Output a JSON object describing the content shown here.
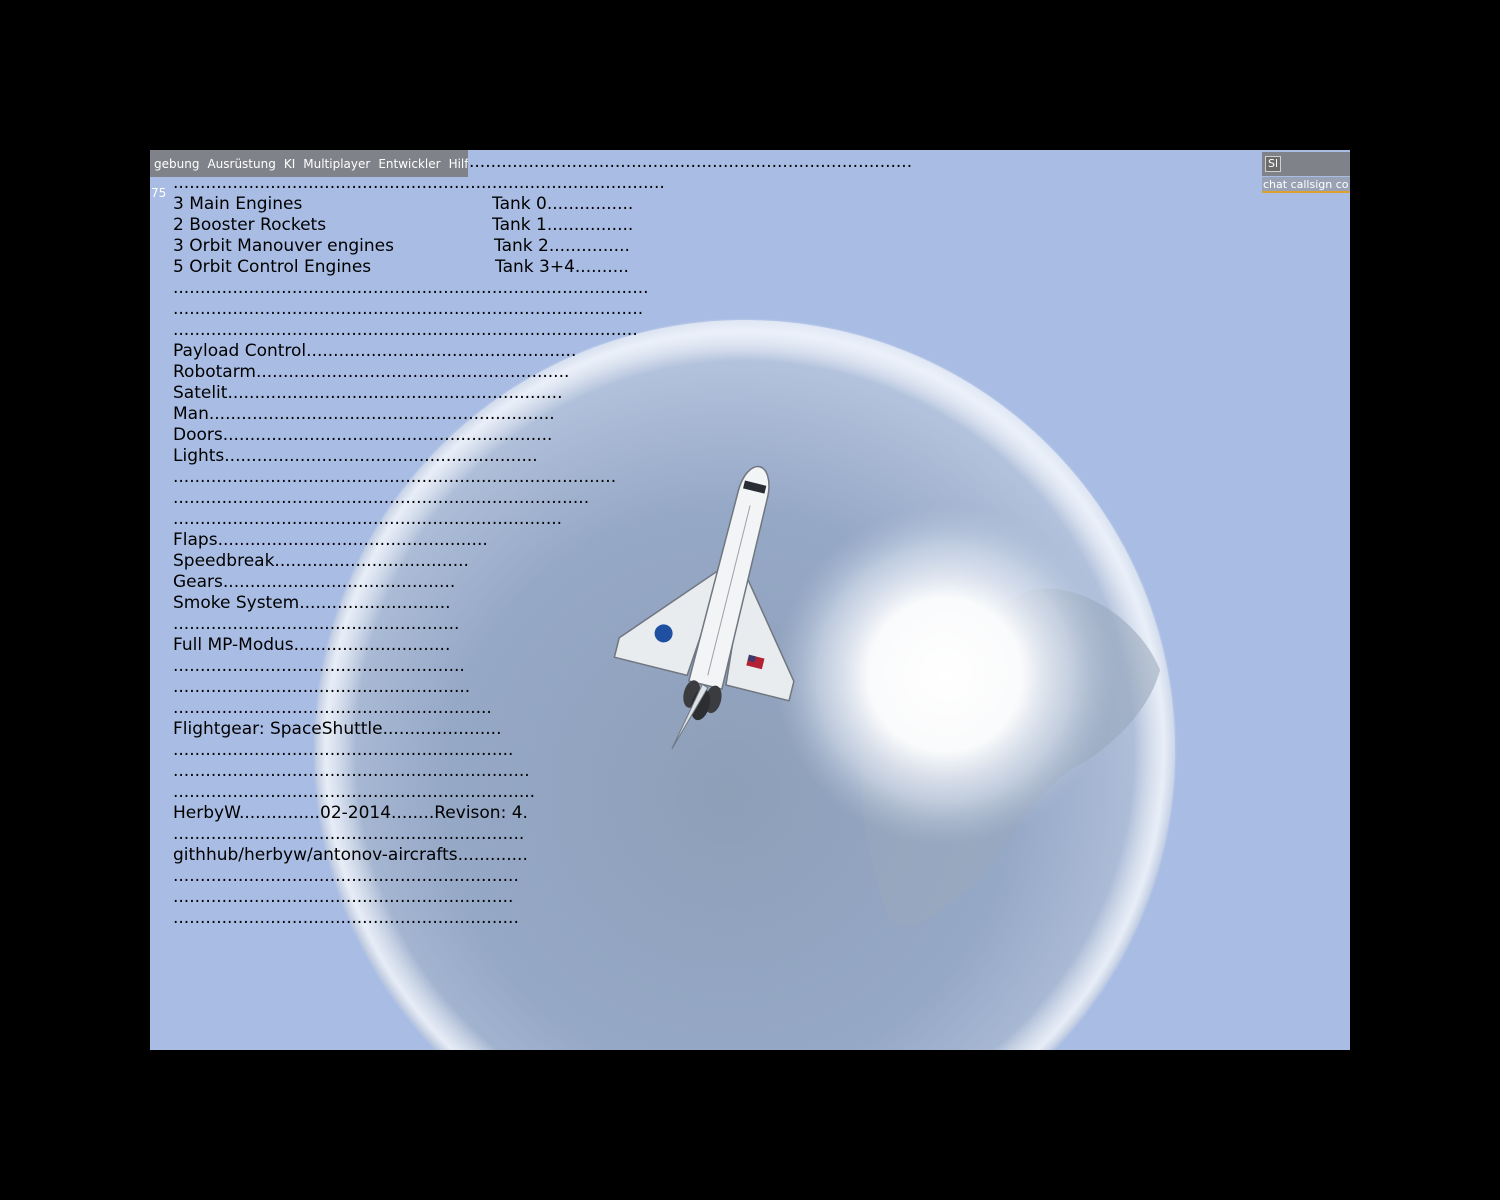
{
  "menubar": {
    "items": [
      "gebung",
      "Ausrüstung",
      "KI",
      "Multiplayer",
      "Entwickler",
      "Hilfe"
    ]
  },
  "hud": {
    "frame_counter": "75"
  },
  "chat": {
    "toggle_label": "Sl",
    "input_text": "chat callsign co"
  },
  "help": {
    "lines": [
      {
        "left": "..................................................................................",
        "right": ""
      },
      {
        "left": "...........................................................................................",
        "right": ""
      },
      {
        "left": "3 Main Engines",
        "right": "Tank 0................"
      },
      {
        "left": "2 Booster Rockets",
        "right": "Tank 1................"
      },
      {
        "left": "3 Orbit Manouver engines",
        "right": "Tank 2..............."
      },
      {
        "left": "5 Orbit Control Engines",
        "right": "Tank 3+4.........."
      },
      {
        "left": "........................................................................................",
        "right": ""
      },
      {
        "left": ".......................................................................................",
        "right": ""
      },
      {
        "left": "......................................................................................",
        "right": ""
      },
      {
        "left": "Payload Control..................................................",
        "right": ""
      },
      {
        "left": "Robotarm..........................................................",
        "right": ""
      },
      {
        "left": "Satelit..............................................................",
        "right": ""
      },
      {
        "left": "Man................................................................",
        "right": ""
      },
      {
        "left": "Doors.............................................................",
        "right": ""
      },
      {
        "left": "Lights..........................................................",
        "right": ""
      },
      {
        "left": "..................................................................................",
        "right": ""
      },
      {
        "left": ".............................................................................",
        "right": ""
      },
      {
        "left": "........................................................................",
        "right": ""
      },
      {
        "left": "Flaps..................................................",
        "right": ""
      },
      {
        "left": "Speedbreak....................................",
        "right": ""
      },
      {
        "left": "Gears...........................................",
        "right": ""
      },
      {
        "left": "Smoke System............................",
        "right": ""
      },
      {
        "left": ".....................................................",
        "right": ""
      },
      {
        "left": "Full MP-Modus.............................",
        "right": ""
      },
      {
        "left": "......................................................",
        "right": ""
      },
      {
        "left": ".......................................................",
        "right": ""
      },
      {
        "left": "...........................................................",
        "right": ""
      },
      {
        "left": "Flightgear: SpaceShuttle......................",
        "right": ""
      },
      {
        "left": "...............................................................",
        "right": ""
      },
      {
        "left": "..................................................................",
        "right": ""
      },
      {
        "left": "...................................................................",
        "right": ""
      },
      {
        "left": "HerbyW...............02-2014........Revison: 4.",
        "right": ""
      },
      {
        "left": ".................................................................",
        "right": ""
      },
      {
        "left": "githhub/herbyw/antonov-aircrafts.............",
        "right": ""
      },
      {
        "left": "................................................................",
        "right": ""
      },
      {
        "left": "...............................................................",
        "right": ""
      },
      {
        "left": "................................................................",
        "right": ""
      }
    ]
  },
  "colors": {
    "sky": "#a9bde4",
    "overlay_gray": "#787878",
    "chat_underline": "#e0a030"
  }
}
